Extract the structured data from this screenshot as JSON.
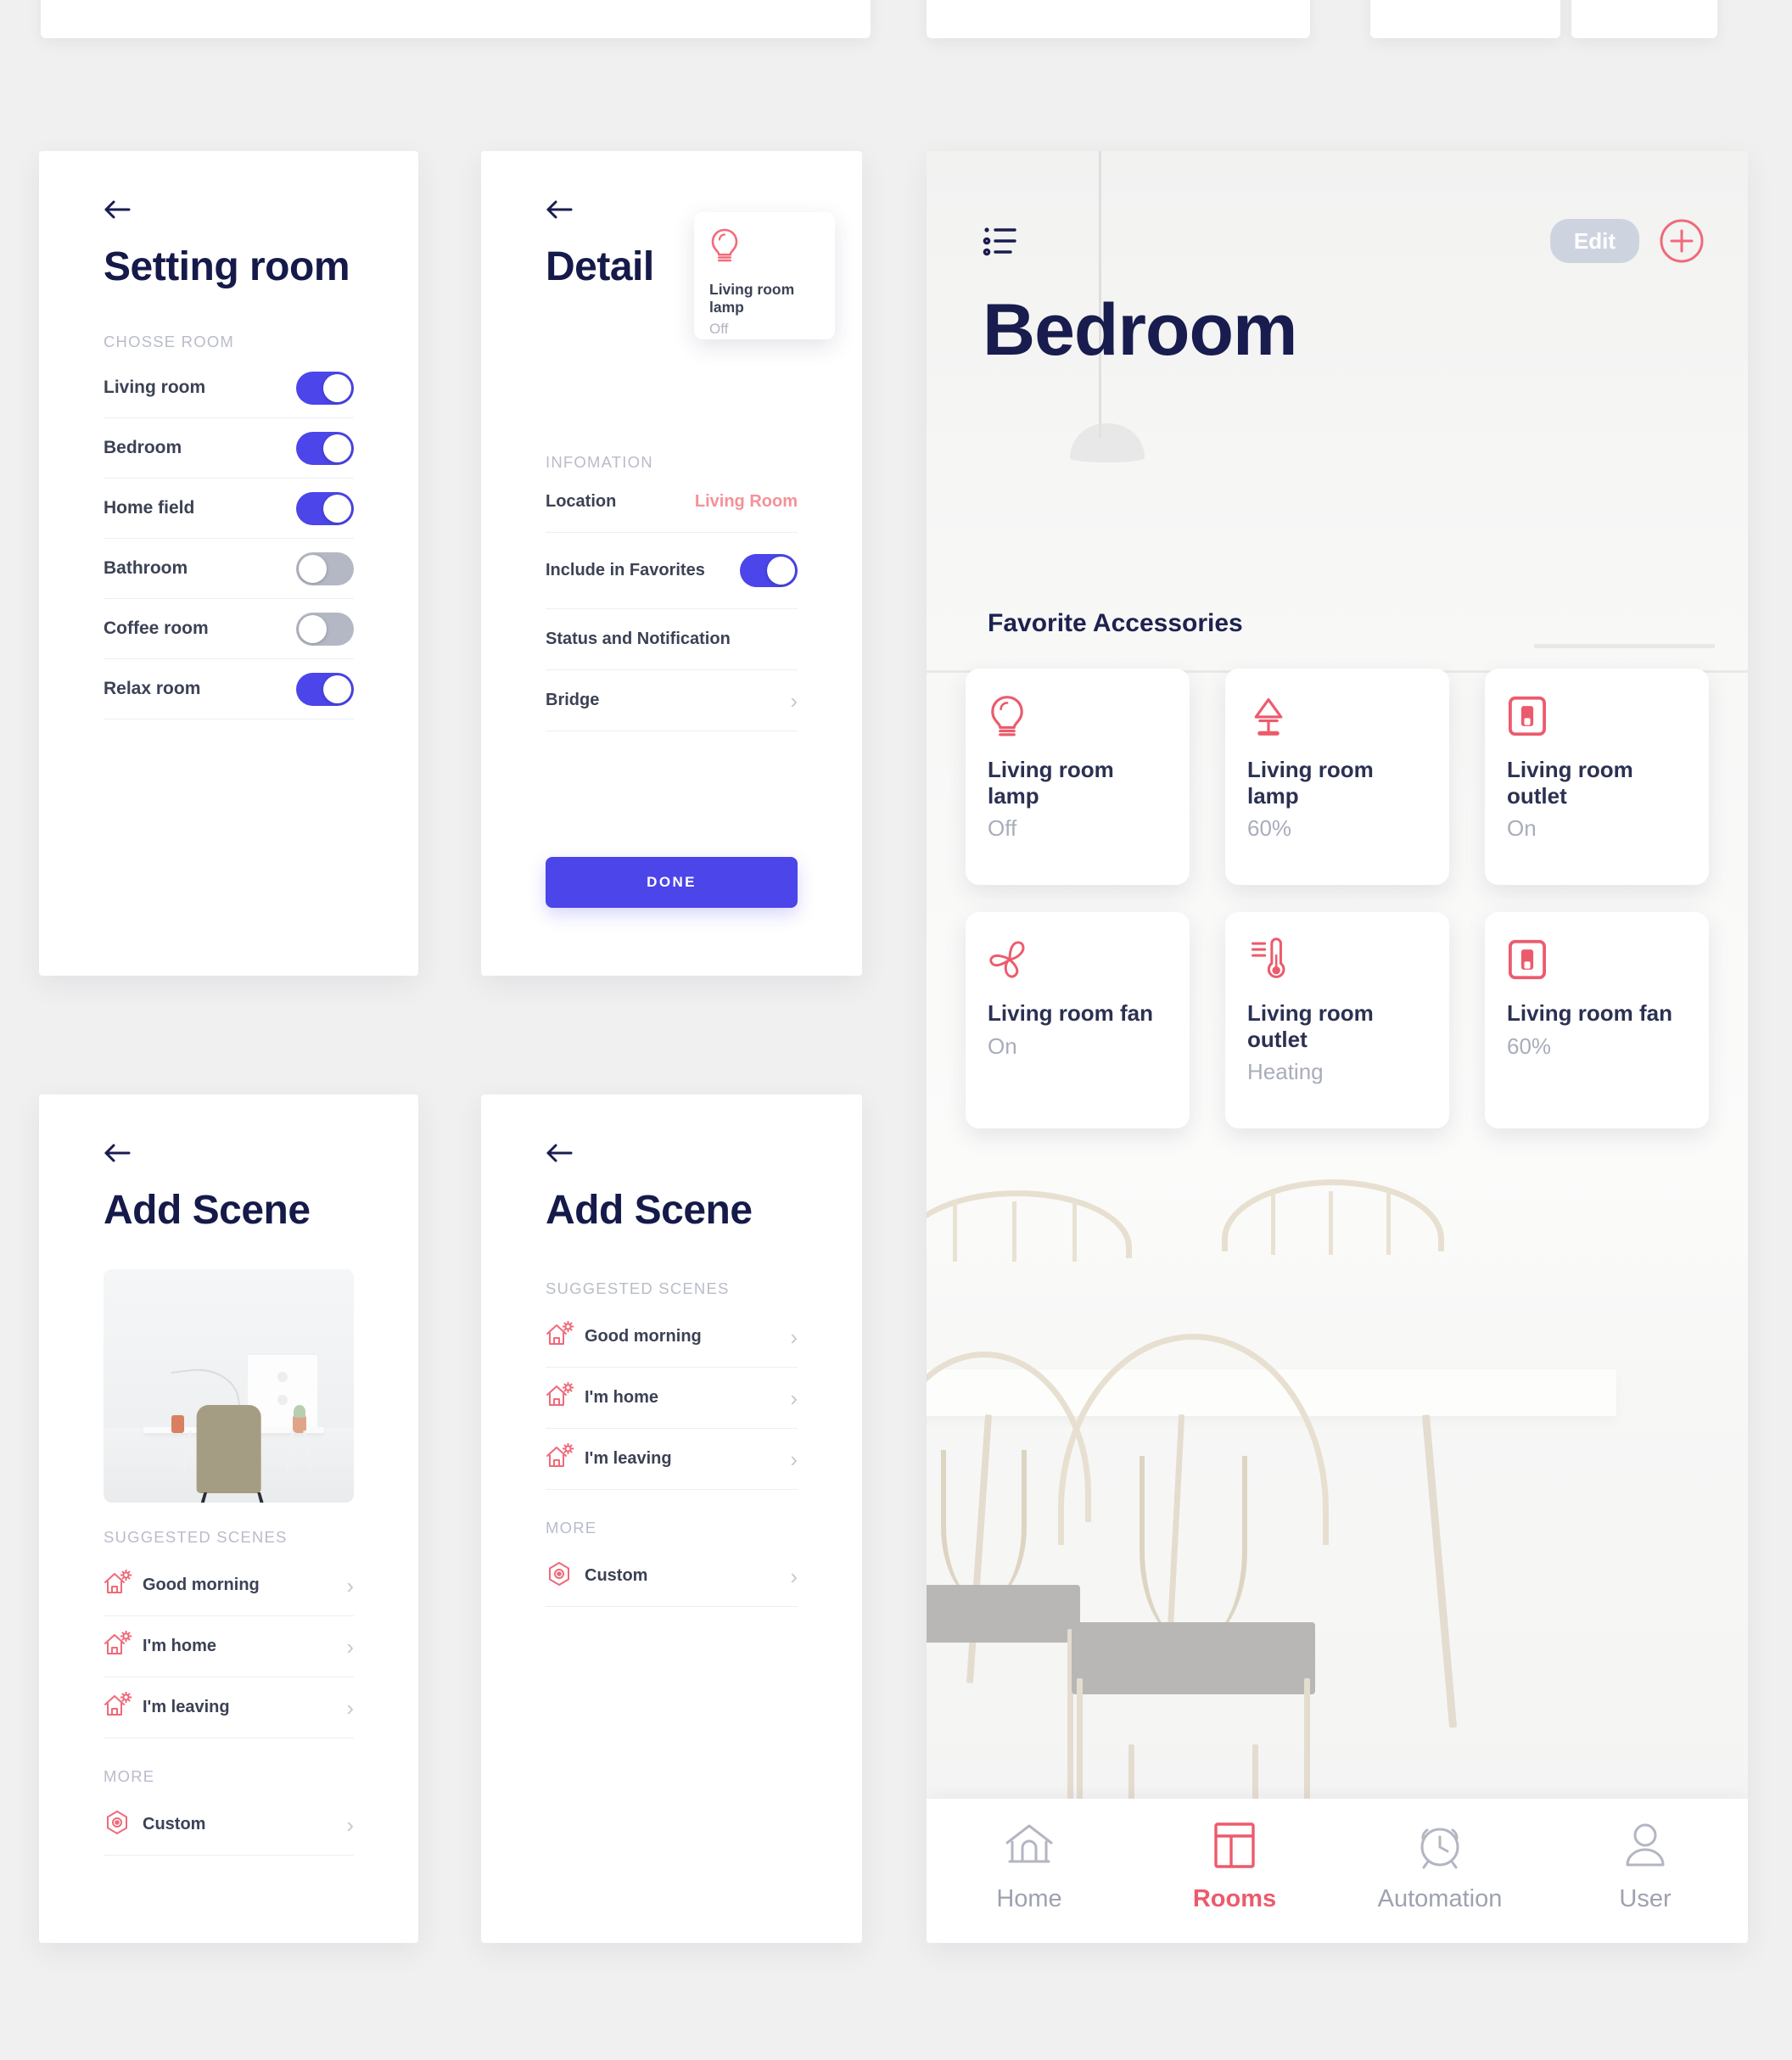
{
  "theme": {
    "accent_red": "#ec5b6c",
    "accent_blue": "#4b45ea",
    "title_navy": "#191c4e",
    "muted_gray": "#b2b5c0",
    "page_bg": "#f0f0f0"
  },
  "setting_room": {
    "back_icon": "arrow-left-icon",
    "title": "Setting room",
    "section_caption": "CHOSSE ROOM",
    "rooms": [
      {
        "name": "Living room",
        "enabled": true
      },
      {
        "name": "Bedroom",
        "enabled": true
      },
      {
        "name": "Home field",
        "enabled": true
      },
      {
        "name": "Bathroom",
        "enabled": false
      },
      {
        "name": "Coffee room",
        "enabled": false
      },
      {
        "name": "Relax room",
        "enabled": true
      }
    ]
  },
  "detail": {
    "back_icon": "arrow-left-icon",
    "title": "Detail",
    "device_card": {
      "icon": "lightbulb-icon",
      "name": "Living room lamp",
      "state": "Off"
    },
    "section_caption": "INFOMATION",
    "rows": [
      {
        "label": "Location",
        "value": "Living Room",
        "type": "value"
      },
      {
        "label": "Include in Favorites",
        "type": "toggle",
        "enabled": true
      },
      {
        "label": "Status and Notification",
        "type": "plain"
      },
      {
        "label": "Bridge",
        "type": "chevron"
      }
    ],
    "done_label": "DONE"
  },
  "add_scene_a": {
    "back_icon": "arrow-left-icon",
    "title": "Add Scene",
    "photo_alt": "minimal white desk with chair",
    "suggested_caption": "SUGGESTED SCENES",
    "suggested": [
      {
        "icon": "house-sun-icon",
        "label": "Good morning"
      },
      {
        "icon": "house-sun-icon",
        "label": "I'm home"
      },
      {
        "icon": "house-sun-icon",
        "label": "I'm leaving"
      }
    ],
    "more_caption": "MORE",
    "more": [
      {
        "icon": "hexagon-gear-icon",
        "label": "Custom"
      }
    ]
  },
  "add_scene_b": {
    "back_icon": "arrow-left-icon",
    "title": "Add Scene",
    "suggested_caption": "SUGGESTED SCENES",
    "suggested": [
      {
        "icon": "house-sun-icon",
        "label": "Good morning"
      },
      {
        "icon": "house-sun-icon",
        "label": "I'm home"
      },
      {
        "icon": "house-sun-icon",
        "label": "I'm leaving"
      }
    ],
    "more_caption": "MORE",
    "more": [
      {
        "icon": "hexagon-gear-icon",
        "label": "Custom"
      }
    ]
  },
  "bedroom": {
    "list_icon": "list-bullets-icon",
    "edit_label": "Edit",
    "add_icon": "plus-circle-icon",
    "title": "Bedroom",
    "favorites_heading": "Favorite Accessories",
    "accessories": [
      {
        "icon": "lightbulb-icon",
        "name": "Living room lamp",
        "state": "Off"
      },
      {
        "icon": "desk-lamp-icon",
        "name": "Living room lamp",
        "state": "60%"
      },
      {
        "icon": "outlet-icon",
        "name": "Living room outlet",
        "state": "On"
      },
      {
        "icon": "fan-icon",
        "name": "Living room fan",
        "state": "On"
      },
      {
        "icon": "thermostat-icon",
        "name": "Living room outlet",
        "state": "Heating"
      },
      {
        "icon": "outlet-icon",
        "name": "Living room fan",
        "state": "60%"
      }
    ],
    "tabs": [
      {
        "icon": "home-icon",
        "label": "Home",
        "active": false
      },
      {
        "icon": "rooms-grid-icon",
        "label": "Rooms",
        "active": true
      },
      {
        "icon": "alarm-clock-icon",
        "label": "Automation",
        "active": false
      },
      {
        "icon": "user-icon",
        "label": "User",
        "active": false
      }
    ]
  }
}
